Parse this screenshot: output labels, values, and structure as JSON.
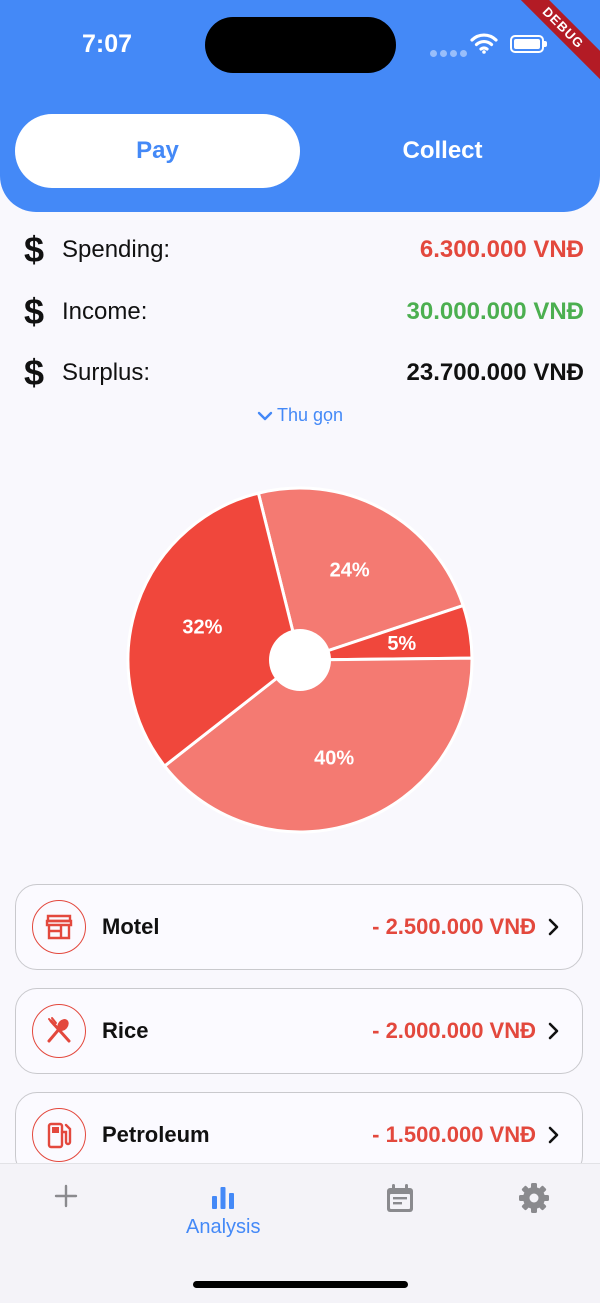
{
  "status": {
    "time": "7:07",
    "debug_banner": "DEBUG"
  },
  "tabs": {
    "pay": "Pay",
    "collect": "Collect"
  },
  "summary": [
    {
      "label": "Spending:",
      "value": "6.300.000 VNĐ",
      "color": "#e3483d"
    },
    {
      "label": "Income:",
      "value": "30.000.000 VNĐ",
      "color": "#4caf50"
    },
    {
      "label": "Surplus:",
      "value": "23.700.000 VNĐ",
      "color": "#111111"
    }
  ],
  "collapse_label": "Thu gọn",
  "chart_data": {
    "type": "pie",
    "slices": [
      {
        "label": "24%",
        "value": 24,
        "color": "#f47a72"
      },
      {
        "label": "5%",
        "value": 5,
        "color": "#f0473c"
      },
      {
        "label": "40%",
        "value": 40,
        "color": "#f47a72"
      },
      {
        "label": "32%",
        "value": 32,
        "color": "#f0473c"
      }
    ]
  },
  "categories": [
    {
      "name": "Motel",
      "amount": "- 2.500.000 VNĐ",
      "icon": "store-icon"
    },
    {
      "name": "Rice",
      "amount": "- 2.000.000 VNĐ",
      "icon": "spoon-fork-icon"
    },
    {
      "name": "Petroleum",
      "amount": "- 1.500.000 VNĐ",
      "icon": "gas-station-icon"
    }
  ],
  "bottom_nav": {
    "analysis": "Analysis"
  }
}
